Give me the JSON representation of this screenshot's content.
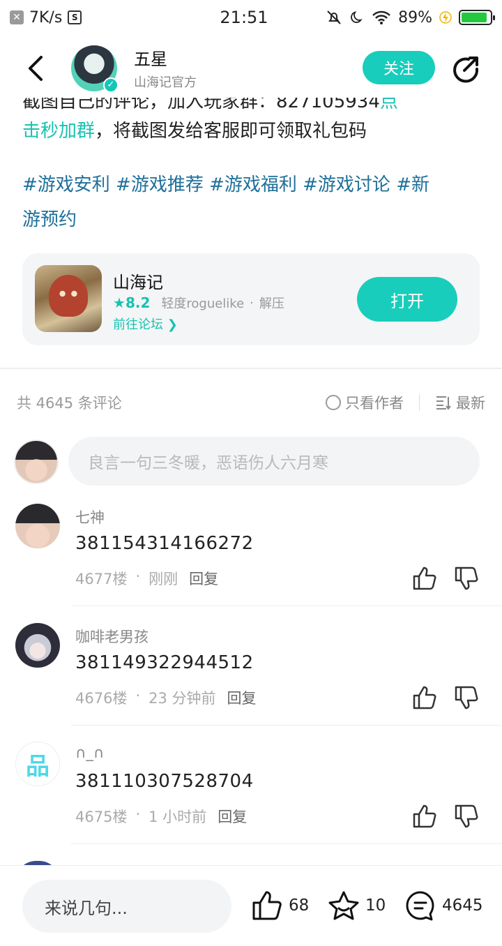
{
  "status_bar": {
    "net_speed": "7K/s",
    "time": "21:51",
    "battery_pct": "89%",
    "battery_level": 0.89
  },
  "header": {
    "name": "五星",
    "subtitle": "山海记官方",
    "follow_label": "关注"
  },
  "post": {
    "cut_line_start": "截图自己的评论，加入玩家群：",
    "cut_line_num": "827105934",
    "cut_line_teal": "点",
    "line2_teal": "击秒加群",
    "line2_rest": "，将截图发给客服即可领取礼包码",
    "tags_line1": "#游戏安利 #游戏推荐 #游戏福利 #游戏讨论 #新",
    "tags_line2": "游预约"
  },
  "game_card": {
    "name": "山海记",
    "rating": "8.2",
    "tag1": "轻度roguelike",
    "dot": "·",
    "tag2": "解压",
    "forum_link": "前往论坛",
    "open_label": "打开"
  },
  "comments_header": {
    "total": "共 4645 条评论",
    "author_only": "只看作者",
    "sort": "最新"
  },
  "comment_input": {
    "placeholder": "良言一句三冬暖，恶语伤人六月寒"
  },
  "comments": [
    {
      "user": "七神",
      "text": "381154314166272",
      "floor": "4677楼",
      "time": "刚刚",
      "reply": "回复"
    },
    {
      "user": "咖啡老男孩",
      "text": "381149322944512",
      "floor": "4676楼",
      "time": "23 分钟前",
      "reply": "回复"
    },
    {
      "user": "∩_∩",
      "text": "381110307528704",
      "floor": "4675楼",
      "time": "1 小时前",
      "reply": "回复"
    }
  ],
  "bottom_bar": {
    "input_placeholder": "来说几句...",
    "likes": "68",
    "favorites": "10",
    "comments": "4645"
  },
  "colors": {
    "accent": "#18cdbb",
    "tag_blue": "#1e6f9a"
  }
}
